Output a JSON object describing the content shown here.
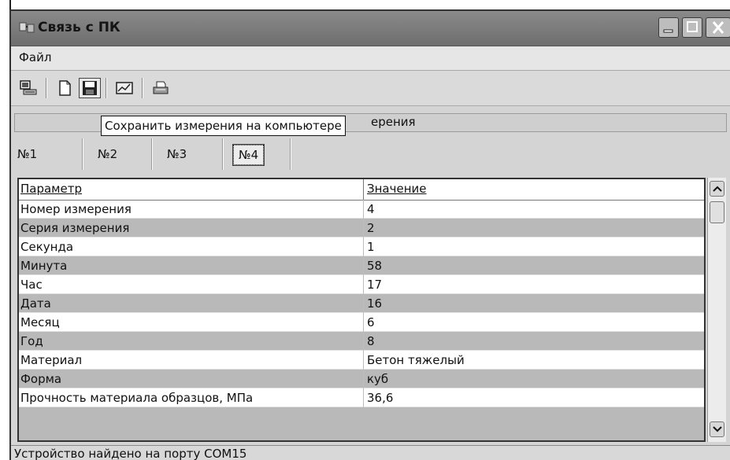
{
  "window": {
    "title": "Связь с ПК"
  },
  "menu": {
    "items": [
      {
        "label": "Файл"
      }
    ]
  },
  "toolbar": {
    "buttons": [
      {
        "icon": "connect-icon"
      },
      {
        "icon": "new-document-icon"
      },
      {
        "icon": "save-icon"
      },
      {
        "icon": "chart-icon"
      },
      {
        "icon": "print-icon"
      }
    ],
    "tooltip": "Сохранить измерения на компьютере"
  },
  "section": {
    "partial_title": "ерения"
  },
  "tabs": [
    {
      "label": "№1"
    },
    {
      "label": "№2"
    },
    {
      "label": "№3"
    },
    {
      "label": "№4",
      "active": true
    }
  ],
  "table": {
    "columns": [
      "Параметр",
      "Значение"
    ],
    "rows": [
      [
        "Номер измерения",
        "4"
      ],
      [
        "Серия измерения",
        "2"
      ],
      [
        "Секунда",
        "1"
      ],
      [
        "Минута",
        "58"
      ],
      [
        "Час",
        "17"
      ],
      [
        "Дата",
        "16"
      ],
      [
        "Месяц",
        "6"
      ],
      [
        "Год",
        "8"
      ],
      [
        "Материал",
        "Бетон тяжелый"
      ],
      [
        "Форма",
        "куб"
      ],
      [
        "Прочность материала образцов, МПа",
        "36,6"
      ]
    ]
  },
  "status": {
    "text": "Устройство найдено на порту COM15"
  }
}
